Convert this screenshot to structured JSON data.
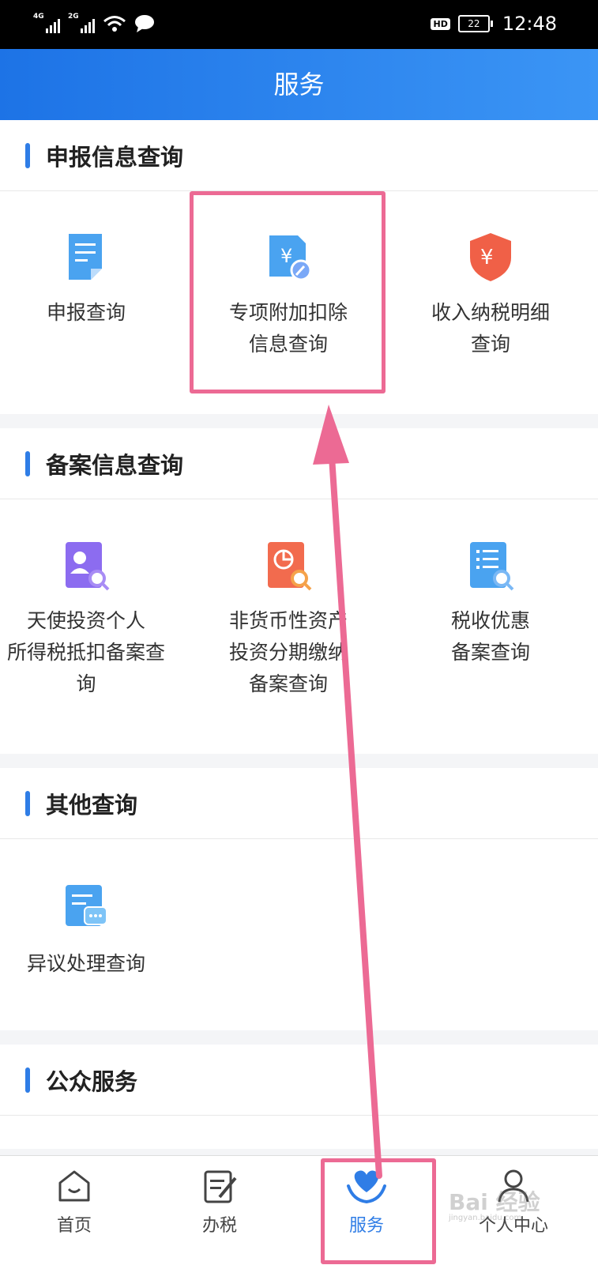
{
  "status": {
    "net1": "4G",
    "net2": "2G",
    "hd": "HD",
    "battery": "22",
    "time": "12:48"
  },
  "header": {
    "title": "服务"
  },
  "sections": [
    {
      "title": "申报信息查询",
      "items": [
        {
          "lines": [
            "申报查询"
          ],
          "icon": "document-icon"
        },
        {
          "lines": [
            "专项附加扣除",
            "信息查询"
          ],
          "icon": "yuan-edit-icon"
        },
        {
          "lines": [
            "收入纳税明细",
            "查询"
          ],
          "icon": "yuan-shield-icon"
        }
      ]
    },
    {
      "title": "备案信息查询",
      "items": [
        {
          "lines": [
            "天使投资个人",
            "所得税抵扣备案查",
            "询"
          ],
          "icon": "person-search-icon"
        },
        {
          "lines": [
            "非货币性资产",
            "投资分期缴纳",
            "备案查询"
          ],
          "icon": "pie-search-icon"
        },
        {
          "lines": [
            "税收优惠",
            "备案查询"
          ],
          "icon": "list-search-icon"
        }
      ]
    },
    {
      "title": "其他查询",
      "items": [
        {
          "lines": [
            "异议处理查询"
          ],
          "icon": "chat-document-icon"
        }
      ]
    },
    {
      "title": "公众服务",
      "items": []
    }
  ],
  "tabs": [
    {
      "label": "首页",
      "icon": "home-icon"
    },
    {
      "label": "办税",
      "icon": "edit-icon"
    },
    {
      "label": "服务",
      "icon": "heart-hand-icon",
      "active": true
    },
    {
      "label": "个人中心",
      "icon": "user-icon"
    }
  ],
  "watermark": {
    "text": "Bai 经验",
    "sub": "jingyan.baidu.com"
  },
  "colors": {
    "header": "#1d73e6",
    "accent": "#2f7de6",
    "highlight": "#ec6a94"
  }
}
